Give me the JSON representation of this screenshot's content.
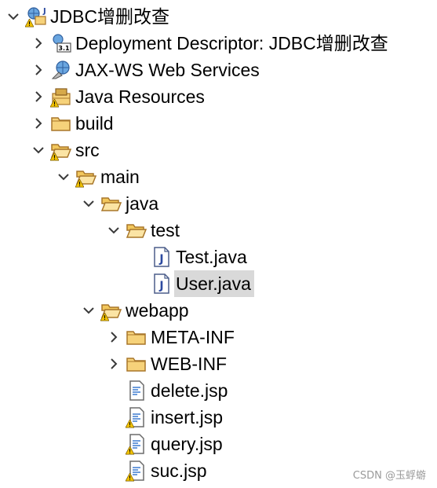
{
  "tree": {
    "rows": [
      {
        "id": "project",
        "label": "JDBC增删改查",
        "indent": 0,
        "expanded": true,
        "icon": "web-project-icon",
        "warn": true
      },
      {
        "id": "deploy",
        "label": "Deployment Descriptor: JDBC增删改查",
        "indent": 1,
        "expanded": false,
        "icon": "deployment-descriptor-icon",
        "warn": false
      },
      {
        "id": "jaxws",
        "label": "JAX-WS Web Services",
        "indent": 1,
        "expanded": false,
        "icon": "web-services-icon",
        "warn": false
      },
      {
        "id": "javares",
        "label": "Java Resources",
        "indent": 1,
        "expanded": false,
        "icon": "java-resources-icon",
        "warn": true
      },
      {
        "id": "build",
        "label": "build",
        "indent": 1,
        "expanded": false,
        "icon": "folder-icon",
        "warn": false
      },
      {
        "id": "src",
        "label": "src",
        "indent": 1,
        "expanded": true,
        "icon": "folder-open-icon",
        "warn": true
      },
      {
        "id": "main",
        "label": "main",
        "indent": 2,
        "expanded": true,
        "icon": "folder-open-icon",
        "warn": true
      },
      {
        "id": "java",
        "label": "java",
        "indent": 3,
        "expanded": true,
        "icon": "folder-open-icon",
        "warn": false
      },
      {
        "id": "test",
        "label": "test",
        "indent": 4,
        "expanded": true,
        "icon": "folder-open-icon",
        "warn": false
      },
      {
        "id": "testjava",
        "label": "Test.java",
        "indent": 5,
        "expanded": null,
        "icon": "java-file-icon",
        "warn": false
      },
      {
        "id": "userjava",
        "label": "User.java",
        "indent": 5,
        "expanded": null,
        "icon": "java-file-icon",
        "warn": false,
        "selected": true
      },
      {
        "id": "webapp",
        "label": "webapp",
        "indent": 3,
        "expanded": true,
        "icon": "folder-open-icon",
        "warn": true
      },
      {
        "id": "metainf",
        "label": "META-INF",
        "indent": 4,
        "expanded": false,
        "icon": "folder-icon",
        "warn": false
      },
      {
        "id": "webinf",
        "label": "WEB-INF",
        "indent": 4,
        "expanded": false,
        "icon": "folder-icon",
        "warn": false
      },
      {
        "id": "delete",
        "label": "delete.jsp",
        "indent": 4,
        "expanded": null,
        "icon": "jsp-file-icon",
        "warn": false
      },
      {
        "id": "insert",
        "label": "insert.jsp",
        "indent": 4,
        "expanded": null,
        "icon": "jsp-file-icon",
        "warn": true
      },
      {
        "id": "query",
        "label": "query.jsp",
        "indent": 4,
        "expanded": null,
        "icon": "jsp-file-icon",
        "warn": true
      },
      {
        "id": "suc",
        "label": "suc.jsp",
        "indent": 4,
        "expanded": null,
        "icon": "jsp-file-icon",
        "warn": true
      }
    ]
  },
  "watermark": "CSDN @玉蜉蝣"
}
